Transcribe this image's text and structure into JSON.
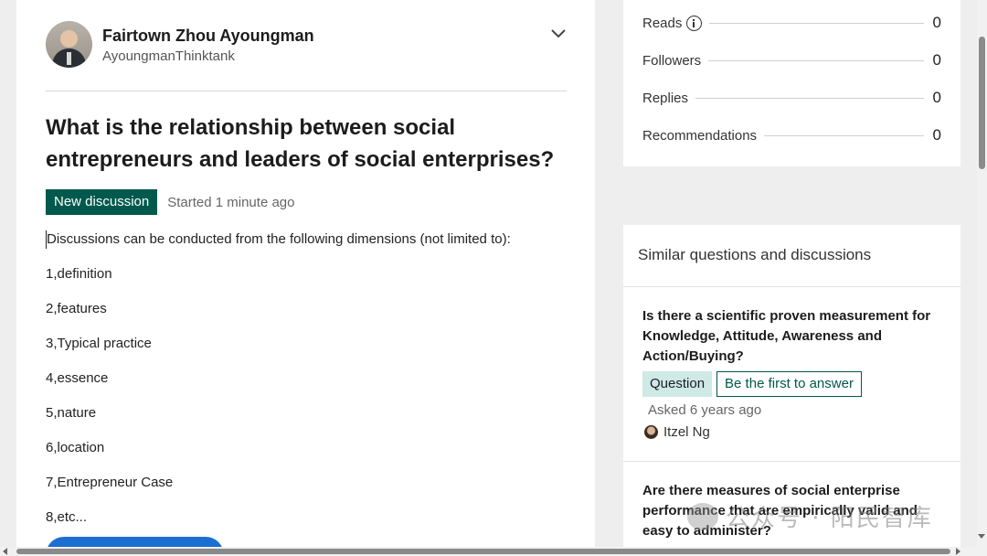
{
  "author": {
    "name": "Fairtown Zhou Ayoungman",
    "handle": "AyoungmanThinktank"
  },
  "question": {
    "title": "What is the relationship between social entrepreneurs and leaders of social enterprises?",
    "badge": "New discussion",
    "started": "Started 1 minute ago",
    "intro": "Discussions can be conducted from the following dimensions (not limited to):",
    "items": [
      "1,definition",
      "2,features",
      "3,Typical practice",
      "4,essence",
      "5,nature",
      "6,location",
      "7,Entrepreneur Case",
      "8,etc..."
    ]
  },
  "stats": [
    {
      "label": "Reads",
      "value": "0",
      "has_info_icon": true
    },
    {
      "label": "Followers",
      "value": "0"
    },
    {
      "label": "Replies",
      "value": "0"
    },
    {
      "label": "Recommendations",
      "value": "0"
    }
  ],
  "similar": {
    "heading": "Similar questions and discussions",
    "items": [
      {
        "title": "Is there a scientific proven measurement for Knowledge, Attitude, Awareness and Action/Buying?",
        "type_tag": "Question",
        "action_tag": "Be the first to answer",
        "asked": "Asked 6 years ago",
        "asker": "Itzel Ng"
      },
      {
        "title": "Are there measures of social enterprise performance that are empirically valid and easy to administer?"
      }
    ]
  },
  "watermark": "公众号 · 阳民智库",
  "colors": {
    "accent_green": "#00594c",
    "question_tag_bg": "#cfe9e7",
    "primary_blue": "#1a6fd1"
  }
}
